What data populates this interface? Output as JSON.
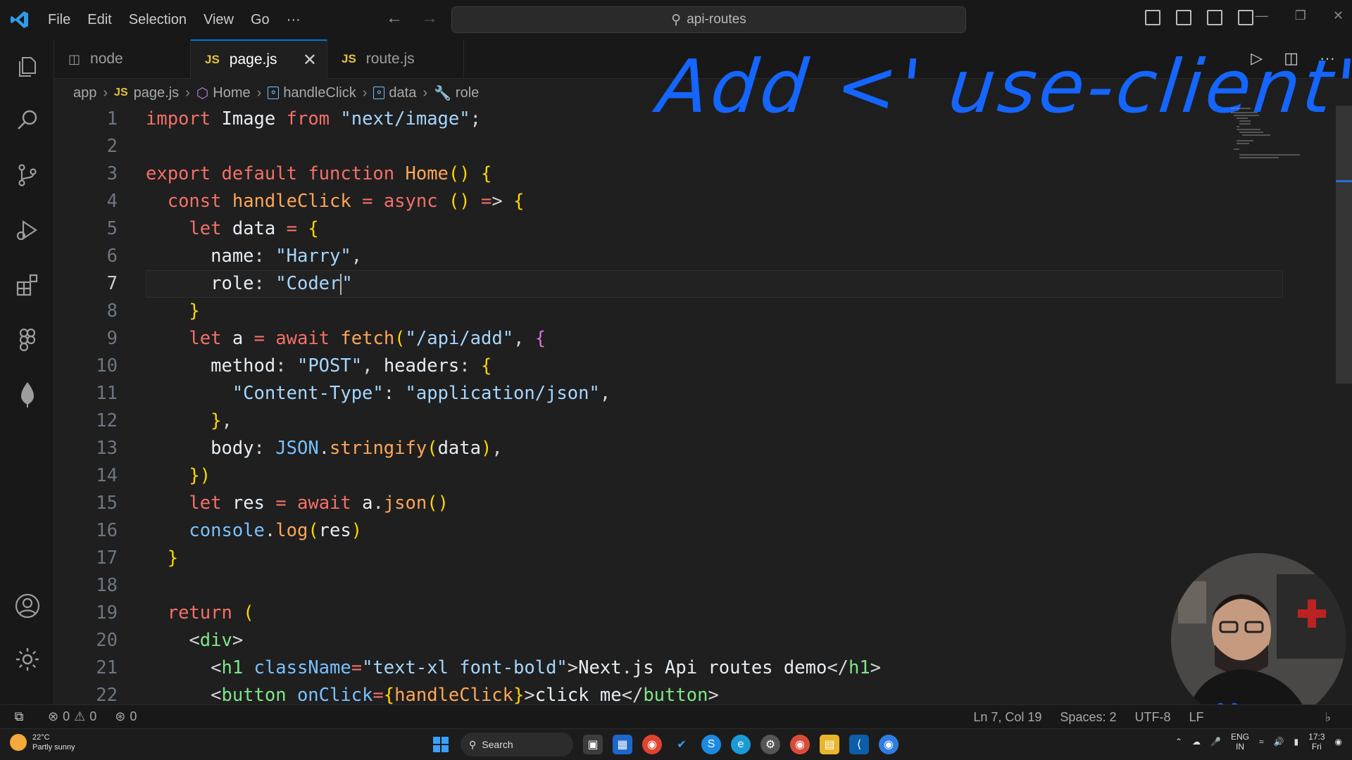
{
  "title_bar": {
    "menus": [
      "File",
      "Edit",
      "Selection",
      "View",
      "Go",
      "···"
    ],
    "command_center": "api-routes"
  },
  "tabs": [
    {
      "icon": "node-icon",
      "label": "node",
      "active": false
    },
    {
      "icon": "js-icon",
      "js": "JS",
      "label": "page.js",
      "active": true,
      "close": "✕"
    },
    {
      "icon": "js-icon",
      "js": "JS",
      "label": "route.js",
      "active": false
    }
  ],
  "breadcrumb": {
    "items": [
      "app",
      "page.js",
      "Home",
      "handleClick",
      "data",
      "role"
    ],
    "js": "JS"
  },
  "annotation": "Add <' use-client' >",
  "editor": {
    "active_line": 7,
    "lines": [
      {
        "n": "1"
      },
      {
        "n": "2"
      },
      {
        "n": "3"
      },
      {
        "n": "4"
      },
      {
        "n": "5"
      },
      {
        "n": "6"
      },
      {
        "n": "7"
      },
      {
        "n": "8"
      },
      {
        "n": "9"
      },
      {
        "n": "10"
      },
      {
        "n": "11"
      },
      {
        "n": "12"
      },
      {
        "n": "13"
      },
      {
        "n": "14"
      },
      {
        "n": "15"
      },
      {
        "n": "16"
      },
      {
        "n": "17"
      },
      {
        "n": "18"
      },
      {
        "n": "19"
      },
      {
        "n": "20"
      },
      {
        "n": "21"
      },
      {
        "n": "22"
      }
    ],
    "code": [
      "import Image from \"next/image\";",
      "",
      "export default function Home() {",
      "  const handleClick = async () => {",
      "    let data = {",
      "      name: \"Harry\",",
      "      role: \"Coder\"",
      "    }",
      "    let a = await fetch(\"/api/add\", {",
      "      method: \"POST\", headers: {",
      "        \"Content-Type\": \"application/json\",",
      "      },",
      "      body: JSON.stringify(data),",
      "    })",
      "    let res = await a.json()",
      "    console.log(res)",
      "  }",
      "",
      "  return (",
      "    <div>",
      "      <h1 className=\"text-xl font-bold\">Next.js Api routes demo</h1>",
      "      <button onClick={handleClick}>click me</button>"
    ]
  },
  "status_bar": {
    "errors": "0",
    "warnings": "0",
    "ports": "0",
    "position": "Ln 7, Col 19",
    "spaces": "Spaces: 2",
    "encoding": "UTF-8",
    "eol": "LF"
  },
  "taskbar": {
    "temp": "22°C",
    "weather": "Partly sunny",
    "search": "Search",
    "lang1": "ENG",
    "lang2": "IN",
    "time": "17:3",
    "day": "Fri"
  },
  "colors": {
    "accent": "#0078d4",
    "annotation": "#1565ff",
    "keyword": "#f47067",
    "string": "#a5d6ff",
    "function": "#ffa657"
  }
}
